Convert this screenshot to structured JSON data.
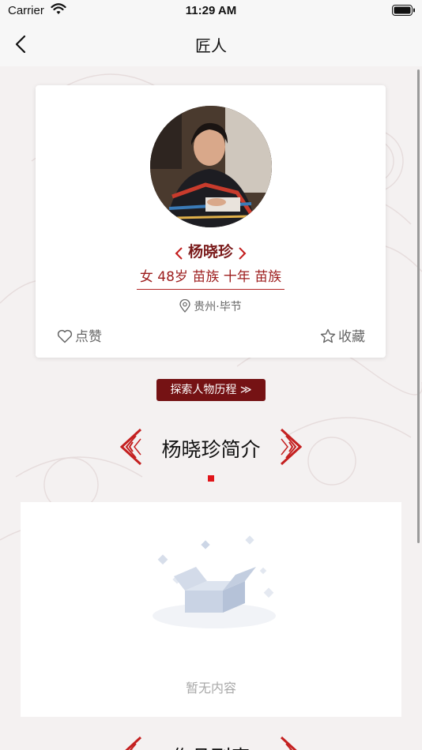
{
  "status": {
    "carrier": "Carrier",
    "time": "11:29 AM"
  },
  "nav": {
    "title": "匠人"
  },
  "profile": {
    "name": "杨晓珍",
    "tags": "女 48岁 苗族 十年 苗族",
    "location": "贵州·毕节",
    "like_label": "点赞",
    "favorite_label": "收藏"
  },
  "explore_button": "探索人物历程 ≫",
  "intro": {
    "title": "杨晓珍简介",
    "empty_text": "暂无内容"
  },
  "works": {
    "title": "作品列表"
  },
  "icons": [
    "wifi-icon",
    "battery-icon",
    "back-arrow-icon",
    "location-pin-icon",
    "heart-icon",
    "star-icon",
    "empty-box-icon"
  ],
  "colors": {
    "accent": "#751214",
    "name": "#7a1b1b",
    "tag": "#9c1c1c",
    "section_deco": "#c42020",
    "dot": "#e0151a"
  }
}
